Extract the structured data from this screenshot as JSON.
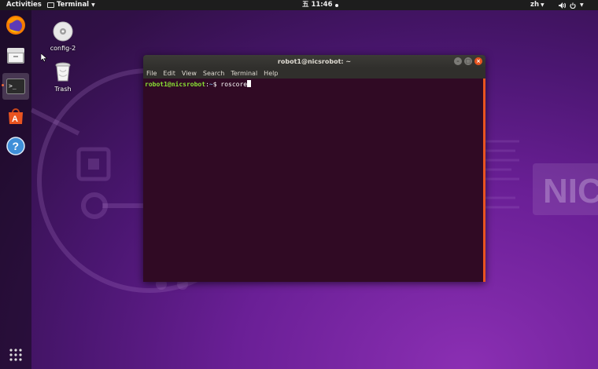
{
  "topbar": {
    "activities": "Activities",
    "app_menu": "Terminal",
    "clock": "五 11:46",
    "input_method": "zh",
    "icons": [
      "volume-icon",
      "power-icon"
    ]
  },
  "dock": {
    "items": [
      {
        "name": "Firefox",
        "icon": "firefox-icon"
      },
      {
        "name": "Files",
        "icon": "files-icon"
      },
      {
        "name": "Terminal",
        "icon": "terminal-icon",
        "active": true
      },
      {
        "name": "Ubuntu Software",
        "icon": "software-icon"
      },
      {
        "name": "Help",
        "icon": "help-icon"
      }
    ],
    "show_apps": "app-grid-icon"
  },
  "desktop": {
    "icons": [
      {
        "label": "config-2",
        "icon": "disc-icon"
      },
      {
        "label": "Trash",
        "icon": "trash-icon"
      }
    ],
    "wallpaper_text": "NIC"
  },
  "window": {
    "title": "robot1@nicsrobot: ~",
    "menu": [
      "File",
      "Edit",
      "View",
      "Search",
      "Terminal",
      "Help"
    ],
    "prompt_user": "robot1@nicsrobot",
    "prompt_sep": ":",
    "prompt_path": "~",
    "prompt_symbol": "$",
    "command": "roscore"
  },
  "colors": {
    "terminal_bg": "#300a24",
    "accent": "#e95420",
    "prompt_user": "#8ae234",
    "prompt_path": "#729fcf"
  }
}
